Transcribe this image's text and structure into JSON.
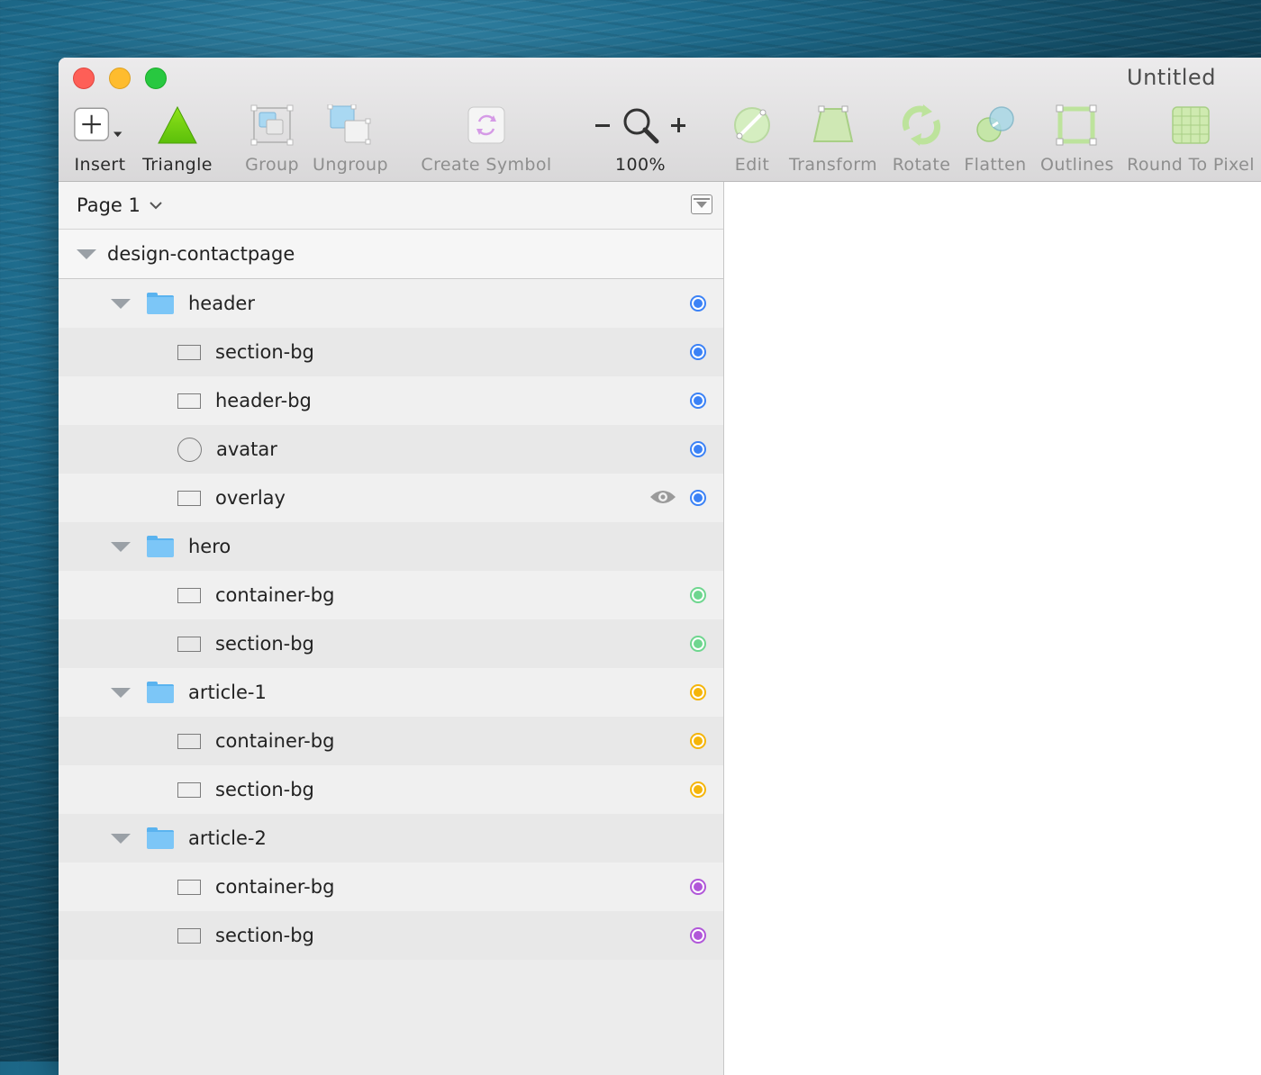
{
  "window": {
    "title": "Untitled"
  },
  "toolbar": {
    "insert": "Insert",
    "triangle": "Triangle",
    "group": "Group",
    "ungroup": "Ungroup",
    "create_symbol": "Create Symbol",
    "zoom_level": "100%",
    "edit": "Edit",
    "transform": "Transform",
    "rotate": "Rotate",
    "flatten": "Flatten",
    "outlines": "Outlines",
    "round_to_pixel": "Round To Pixel"
  },
  "sidebar": {
    "page": "Page 1",
    "artboard": "design-contactpage",
    "layers": [
      {
        "name": "header",
        "kind": "folder",
        "color": "#3b82f6"
      },
      {
        "name": "section-bg",
        "kind": "rect",
        "color": "#3b82f6"
      },
      {
        "name": "header-bg",
        "kind": "rect",
        "color": "#3b82f6"
      },
      {
        "name": "avatar",
        "kind": "oval",
        "color": "#3b82f6"
      },
      {
        "name": "overlay",
        "kind": "rect",
        "color": "#3b82f6",
        "eye": true
      },
      {
        "name": "hero",
        "kind": "folder",
        "color": null
      },
      {
        "name": "container-bg",
        "kind": "rect",
        "color": "#6fd68f"
      },
      {
        "name": "section-bg",
        "kind": "rect",
        "color": "#6fd68f"
      },
      {
        "name": "article-1",
        "kind": "folder",
        "color": "#f5b50a"
      },
      {
        "name": "container-bg",
        "kind": "rect",
        "color": "#f5b50a"
      },
      {
        "name": "section-bg",
        "kind": "rect",
        "color": "#f5b50a"
      },
      {
        "name": "article-2",
        "kind": "folder",
        "color": null
      },
      {
        "name": "container-bg",
        "kind": "rect",
        "color": "#b157d9"
      },
      {
        "name": "section-bg",
        "kind": "rect",
        "color": "#b157d9"
      }
    ]
  }
}
